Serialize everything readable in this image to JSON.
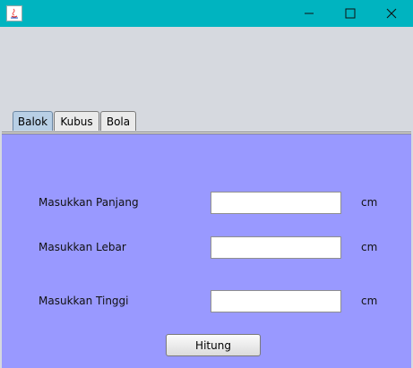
{
  "window": {
    "title": "",
    "controls": {
      "minimize_icon": "minimize-icon",
      "maximize_icon": "maximize-icon",
      "close_icon": "close-icon"
    },
    "title_bar_color": "#00b4c0",
    "app_icon": "java-icon"
  },
  "tabs": [
    {
      "label": "Balok",
      "active": true
    },
    {
      "label": "Kubus",
      "active": false
    },
    {
      "label": "Bola",
      "active": false
    }
  ],
  "panel": {
    "background": "#9999ff",
    "fields": [
      {
        "label": "Masukkan Panjang",
        "value": "",
        "unit": "cm"
      },
      {
        "label": "Masukkan Lebar",
        "value": "",
        "unit": "cm"
      },
      {
        "label": "Masukkan Tinggi",
        "value": "",
        "unit": "cm"
      }
    ],
    "button_label": "Hitung"
  }
}
